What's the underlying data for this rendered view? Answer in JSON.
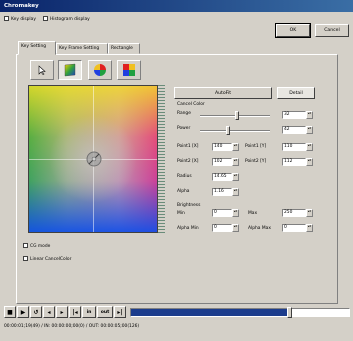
{
  "window": {
    "title": "Chromakey"
  },
  "options": {
    "key_display": "Key display",
    "histogram_display": "Histogram display"
  },
  "buttons": {
    "ok": "OK",
    "cancel": "Cancel",
    "autofit": "AutoFit",
    "detail": "Detail"
  },
  "tabs": [
    {
      "label": "Key Setting",
      "active": true
    },
    {
      "label": "Key Frame Setting",
      "active": false
    },
    {
      "label": "Rectangle",
      "active": false
    }
  ],
  "tools": [
    {
      "icon": "arrow-pointer-icon",
      "pressed": false
    },
    {
      "icon": "color-sphere-icon",
      "pressed": true
    },
    {
      "icon": "color-wheel-icon",
      "pressed": false
    },
    {
      "icon": "color-square-icon",
      "pressed": false
    }
  ],
  "cancel_color": {
    "title": "Cancel Color",
    "range_label": "Range",
    "range_value": "32",
    "power_label": "Power",
    "power_value": "42"
  },
  "params": {
    "point1x_label": "Point1 [X]",
    "point1x_value": "140",
    "point1y_label": "Point1 [Y]",
    "point1y_value": "110",
    "point2x_label": "Point2 [X]",
    "point2x_value": "102",
    "point2y_label": "Point2 [Y]",
    "point2y_value": "112",
    "radius_label": "Radius",
    "radius_value": "14.65",
    "alpha_label": "Alpha",
    "alpha_value": "1.16"
  },
  "brightness": {
    "title": "Brightness",
    "min_label": "Min",
    "min_value": "0",
    "max_label": "Max",
    "max_value": "250",
    "alpha_min_label": "Alpha Min",
    "alpha_min_value": "0",
    "alpha_max_label": "Alpha Max",
    "alpha_max_value": "0"
  },
  "bottom_options": {
    "cg_mode": "CG mode",
    "linear_cancel": "Linear CancelColor"
  },
  "transport": {
    "in_label": "in",
    "out_label": "out"
  },
  "status": {
    "timecode": "00:00:01;19(49) / IN: 00:00:00;00(0) / OUT: 00:00:05;00(126)"
  },
  "colors": {
    "title_start": "#0a246a",
    "title_end": "#3a6ea5",
    "progress": "#1c3c8c"
  }
}
